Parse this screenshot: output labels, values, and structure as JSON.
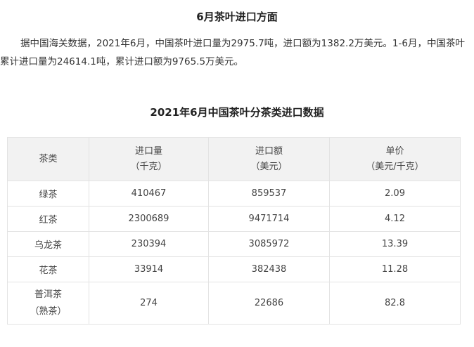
{
  "section": {
    "title": "6月茶叶进口方面",
    "paragraph": "据中国海关数据，2021年6月，中国茶叶进口量为2975.7吨，进口额为1382.2万美元。1-6月，中国茶叶累计进口量为24614.1吨，累计进口额为9765.5万美元。"
  },
  "table": {
    "title": "2021年6月中国茶叶分茶类进口数据",
    "headers": [
      {
        "line1": "茶类",
        "line2": ""
      },
      {
        "line1": "进口量",
        "line2": "（千克）"
      },
      {
        "line1": "进口额",
        "line2": "（美元）"
      },
      {
        "line1": "单价",
        "line2": "（美元/千克）"
      }
    ],
    "rows": [
      {
        "type_line1": "绿茶",
        "type_line2": "",
        "volume": "410467",
        "value": "859537",
        "unit_price": "2.09"
      },
      {
        "type_line1": "红茶",
        "type_line2": "",
        "volume": "2300689",
        "value": "9471714",
        "unit_price": "4.12"
      },
      {
        "type_line1": "乌龙茶",
        "type_line2": "",
        "volume": "230394",
        "value": "3085972",
        "unit_price": "13.39"
      },
      {
        "type_line1": "花茶",
        "type_line2": "",
        "volume": "33914",
        "value": "382438",
        "unit_price": "11.28"
      },
      {
        "type_line1": "普洱茶",
        "type_line2": "（熟茶）",
        "volume": "274",
        "value": "22686",
        "unit_price": "82.8"
      }
    ]
  }
}
